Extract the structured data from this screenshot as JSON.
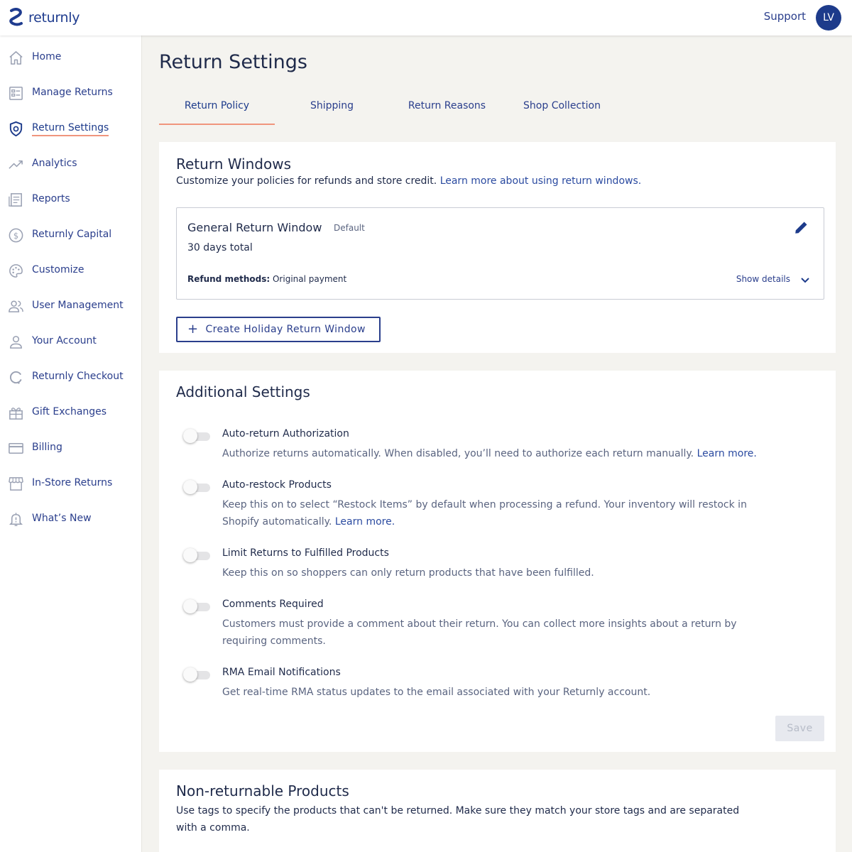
{
  "header": {
    "logo_text": "returnly",
    "support_label": "Support",
    "avatar_initials": "LV"
  },
  "sidebar": {
    "items": [
      {
        "label": "Home",
        "icon": "home-icon"
      },
      {
        "label": "Manage Returns",
        "icon": "list-icon"
      },
      {
        "label": "Return Settings",
        "icon": "shield-icon",
        "active": true
      },
      {
        "label": "Analytics",
        "icon": "trend-icon"
      },
      {
        "label": "Reports",
        "icon": "document-icon"
      },
      {
        "label": "Returnly Capital",
        "icon": "dollar-icon"
      },
      {
        "label": "Customize",
        "icon": "palette-icon"
      },
      {
        "label": "User Management",
        "icon": "users-icon"
      },
      {
        "label": "Your Account",
        "icon": "user-icon"
      },
      {
        "label": "Returnly Checkout",
        "icon": "refresh-icon"
      },
      {
        "label": "Gift Exchanges",
        "icon": "gift-icon"
      },
      {
        "label": "Billing",
        "icon": "credit-card-icon"
      },
      {
        "label": "In-Store Returns",
        "icon": "store-icon"
      },
      {
        "label": "What’s New",
        "icon": "bell-icon"
      }
    ]
  },
  "page": {
    "title": "Return Settings",
    "tabs": [
      {
        "label": "Return Policy",
        "active": true
      },
      {
        "label": "Shipping"
      },
      {
        "label": "Return Reasons"
      },
      {
        "label": "Shop Collection"
      }
    ]
  },
  "return_windows": {
    "title": "Return Windows",
    "subtitle": "Customize your policies for refunds and store credit.",
    "subtitle_link": "Learn more about using return windows.",
    "window": {
      "name": "General Return Window",
      "tag": "Default",
      "duration": "30 days total",
      "refund_label": "Refund methods:",
      "refund_value": "Original payment",
      "show_details": "Show details"
    },
    "create_button": "Create Holiday Return Window"
  },
  "additional_settings": {
    "title": "Additional Settings",
    "settings": [
      {
        "title": "Auto-return Authorization",
        "desc": "Authorize returns automatically. When disabled, you’ll need to authorize each return manually.",
        "link": "Learn more.",
        "enabled": false
      },
      {
        "title": "Auto-restock Products",
        "desc": "Keep this on to select “Restock Items” by default when processing a refund. Your inventory will restock in Shopify automatically.",
        "link": "Learn more.",
        "enabled": false
      },
      {
        "title": "Limit Returns to Fulfilled Products",
        "desc": "Keep this on so shoppers can only return products that have been fulfilled.",
        "link": "",
        "enabled": false
      },
      {
        "title": "Comments Required",
        "desc": "Customers must provide a comment about their return. You can collect more insights about a return by requiring comments.",
        "link": "",
        "enabled": false
      },
      {
        "title": "RMA Email Notifications",
        "desc": "Get real-time RMA status updates to the email associated with your Returnly account.",
        "link": "",
        "enabled": false
      }
    ],
    "save_label": "Save"
  },
  "non_returnable": {
    "title": "Non-returnable Products",
    "desc": "Use tags to specify the products that can't be returned. Make sure they match your store tags and are separated with a comma."
  },
  "colors": {
    "brand": "#1d3b8b",
    "accent": "#f0957d",
    "background": "#f4f3ef"
  }
}
